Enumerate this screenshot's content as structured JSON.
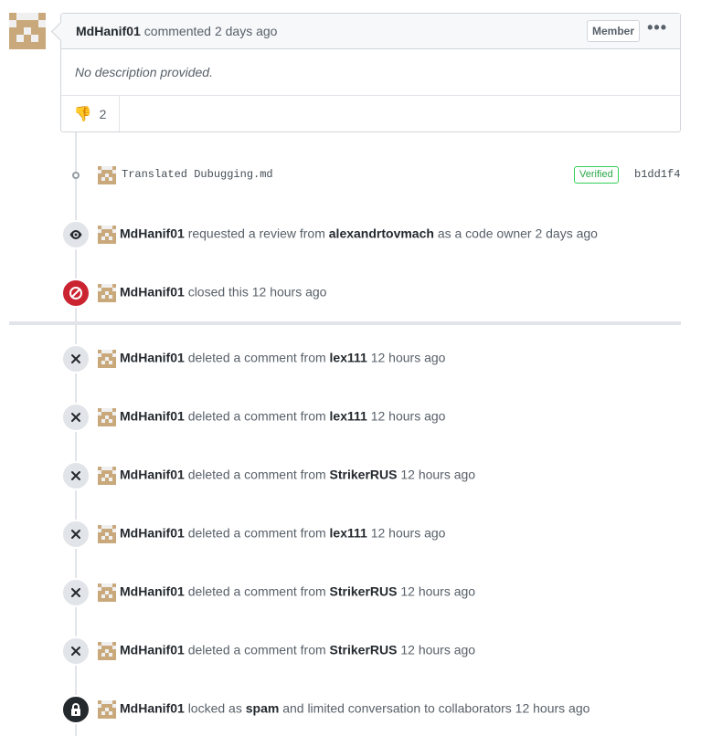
{
  "comment": {
    "author": "MdHanif01",
    "action": "commented",
    "time": "2 days ago",
    "badge": "Member",
    "more": "•••",
    "body": "No description provided.",
    "reaction": {
      "emoji": "👎",
      "count": "2"
    }
  },
  "commit": {
    "message": "Translated Dubugging.md",
    "verified": "Verified",
    "sha": "b1dd1f4"
  },
  "events": [
    {
      "icon": "eye-icon",
      "actor": "MdHanif01",
      "t1": "requested a review from",
      "target": "alexandrtovmach",
      "t2": "as a code owner",
      "time": "2 days ago"
    },
    {
      "icon": "circle-slash-icon",
      "actor": "MdHanif01",
      "t1": "closed this",
      "target": "",
      "t2": "",
      "time": "12 hours ago"
    },
    {
      "icon": "x-icon",
      "actor": "MdHanif01",
      "t1": "deleted a comment from",
      "target": "lex111",
      "t2": "",
      "time": "12 hours ago"
    },
    {
      "icon": "x-icon",
      "actor": "MdHanif01",
      "t1": "deleted a comment from",
      "target": "lex111",
      "t2": "",
      "time": "12 hours ago"
    },
    {
      "icon": "x-icon",
      "actor": "MdHanif01",
      "t1": "deleted a comment from",
      "target": "StrikerRUS",
      "t2": "",
      "time": "12 hours ago"
    },
    {
      "icon": "x-icon",
      "actor": "MdHanif01",
      "t1": "deleted a comment from",
      "target": "lex111",
      "t2": "",
      "time": "12 hours ago"
    },
    {
      "icon": "x-icon",
      "actor": "MdHanif01",
      "t1": "deleted a comment from",
      "target": "StrikerRUS",
      "t2": "",
      "time": "12 hours ago"
    },
    {
      "icon": "x-icon",
      "actor": "MdHanif01",
      "t1": "deleted a comment from",
      "target": "StrikerRUS",
      "t2": "",
      "time": "12 hours ago"
    },
    {
      "icon": "lock-icon",
      "actor": "MdHanif01",
      "t1": "locked as",
      "target": "spam",
      "t2": "and limited conversation to collaborators",
      "time": "12 hours ago"
    }
  ],
  "colors": {
    "red": "#cb2431",
    "dark": "#24292e",
    "grey": "#e1e4e8",
    "avatar": "#d6c4a5"
  }
}
